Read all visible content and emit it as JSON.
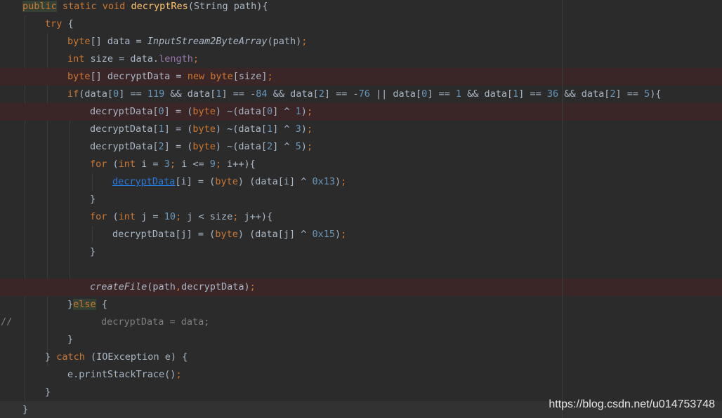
{
  "lines": [
    {
      "indent": 1,
      "parts": [
        {
          "t": "public",
          "c": "kw kwhl"
        },
        {
          "t": " static void ",
          "c": "kw"
        },
        {
          "t": "decryptRes",
          "c": "fn"
        },
        {
          "t": "(String path){",
          "c": ""
        }
      ]
    },
    {
      "indent": 2,
      "parts": [
        {
          "t": "try",
          "c": "kw"
        },
        {
          "t": " {",
          "c": ""
        }
      ]
    },
    {
      "indent": 3,
      "parts": [
        {
          "t": "byte",
          "c": "kw"
        },
        {
          "t": "[] data = ",
          "c": ""
        },
        {
          "t": "InputStream2ByteArray",
          "c": "st"
        },
        {
          "t": "(path)",
          "c": ""
        },
        {
          "t": ";",
          "c": "kw"
        }
      ]
    },
    {
      "indent": 3,
      "parts": [
        {
          "t": "int",
          "c": "kw"
        },
        {
          "t": " size = data.",
          "c": ""
        },
        {
          "t": "length",
          "c": "fld"
        },
        {
          "t": ";",
          "c": "kw"
        }
      ]
    },
    {
      "indent": 3,
      "style": "err",
      "parts": [
        {
          "t": "byte",
          "c": "kw"
        },
        {
          "t": "[] decryptData = ",
          "c": ""
        },
        {
          "t": "new ",
          "c": "kw"
        },
        {
          "t": "byte",
          "c": "kw"
        },
        {
          "t": "[size]",
          "c": ""
        },
        {
          "t": ";",
          "c": "kw"
        }
      ]
    },
    {
      "indent": 3,
      "parts": [
        {
          "t": "if",
          "c": "kw"
        },
        {
          "t": "(data[",
          "c": ""
        },
        {
          "t": "0",
          "c": "num"
        },
        {
          "t": "] == ",
          "c": ""
        },
        {
          "t": "119",
          "c": "num"
        },
        {
          "t": " && data[",
          "c": ""
        },
        {
          "t": "1",
          "c": "num"
        },
        {
          "t": "] == -",
          "c": ""
        },
        {
          "t": "84",
          "c": "num"
        },
        {
          "t": " && data[",
          "c": ""
        },
        {
          "t": "2",
          "c": "num"
        },
        {
          "t": "] == -",
          "c": ""
        },
        {
          "t": "76",
          "c": "num"
        },
        {
          "t": " || data[",
          "c": ""
        },
        {
          "t": "0",
          "c": "num"
        },
        {
          "t": "] == ",
          "c": ""
        },
        {
          "t": "1",
          "c": "num"
        },
        {
          "t": " && data[",
          "c": ""
        },
        {
          "t": "1",
          "c": "num"
        },
        {
          "t": "] == ",
          "c": ""
        },
        {
          "t": "36",
          "c": "num"
        },
        {
          "t": " && data[",
          "c": ""
        },
        {
          "t": "2",
          "c": "num"
        },
        {
          "t": "] == ",
          "c": ""
        },
        {
          "t": "5",
          "c": "num"
        },
        {
          "t": "){",
          "c": ""
        }
      ]
    },
    {
      "indent": 4,
      "style": "err",
      "parts": [
        {
          "t": "decryptData[",
          "c": ""
        },
        {
          "t": "0",
          "c": "num"
        },
        {
          "t": "] = (",
          "c": ""
        },
        {
          "t": "byte",
          "c": "kw"
        },
        {
          "t": ") ~(data[",
          "c": ""
        },
        {
          "t": "0",
          "c": "num"
        },
        {
          "t": "] ^ ",
          "c": ""
        },
        {
          "t": "1",
          "c": "num"
        },
        {
          "t": ")",
          "c": ""
        },
        {
          "t": ";",
          "c": "kw"
        }
      ]
    },
    {
      "indent": 4,
      "parts": [
        {
          "t": "decryptData[",
          "c": ""
        },
        {
          "t": "1",
          "c": "num"
        },
        {
          "t": "] = (",
          "c": ""
        },
        {
          "t": "byte",
          "c": "kw"
        },
        {
          "t": ") ~(data[",
          "c": ""
        },
        {
          "t": "1",
          "c": "num"
        },
        {
          "t": "] ^ ",
          "c": ""
        },
        {
          "t": "3",
          "c": "num"
        },
        {
          "t": ")",
          "c": ""
        },
        {
          "t": ";",
          "c": "kw"
        }
      ]
    },
    {
      "indent": 4,
      "parts": [
        {
          "t": "decryptData[",
          "c": ""
        },
        {
          "t": "2",
          "c": "num"
        },
        {
          "t": "] = (",
          "c": ""
        },
        {
          "t": "byte",
          "c": "kw"
        },
        {
          "t": ") ~(data[",
          "c": ""
        },
        {
          "t": "2",
          "c": "num"
        },
        {
          "t": "] ^ ",
          "c": ""
        },
        {
          "t": "5",
          "c": "num"
        },
        {
          "t": ")",
          "c": ""
        },
        {
          "t": ";",
          "c": "kw"
        }
      ]
    },
    {
      "indent": 4,
      "parts": [
        {
          "t": "for",
          "c": "kw"
        },
        {
          "t": " (",
          "c": ""
        },
        {
          "t": "int",
          "c": "kw"
        },
        {
          "t": " i = ",
          "c": ""
        },
        {
          "t": "3",
          "c": "num"
        },
        {
          "t": "; ",
          "c": "kw"
        },
        {
          "t": "i <= ",
          "c": ""
        },
        {
          "t": "9",
          "c": "num"
        },
        {
          "t": "; ",
          "c": "kw"
        },
        {
          "t": "i++){",
          "c": ""
        }
      ]
    },
    {
      "indent": 5,
      "parts": [
        {
          "t": "decryptData",
          "c": "link"
        },
        {
          "t": "[i] = (",
          "c": ""
        },
        {
          "t": "byte",
          "c": "kw"
        },
        {
          "t": ") (data[i] ^ ",
          "c": ""
        },
        {
          "t": "0x13",
          "c": "num"
        },
        {
          "t": ")",
          "c": ""
        },
        {
          "t": ";",
          "c": "kw"
        }
      ]
    },
    {
      "indent": 4,
      "parts": [
        {
          "t": "}",
          "c": ""
        }
      ]
    },
    {
      "indent": 4,
      "parts": [
        {
          "t": "for",
          "c": "kw"
        },
        {
          "t": " (",
          "c": ""
        },
        {
          "t": "int",
          "c": "kw"
        },
        {
          "t": " j = ",
          "c": ""
        },
        {
          "t": "10",
          "c": "num"
        },
        {
          "t": "; ",
          "c": "kw"
        },
        {
          "t": "j < size",
          "c": ""
        },
        {
          "t": "; ",
          "c": "kw"
        },
        {
          "t": "j++){",
          "c": ""
        }
      ]
    },
    {
      "indent": 5,
      "parts": [
        {
          "t": "decryptData[j] = (",
          "c": ""
        },
        {
          "t": "byte",
          "c": "kw"
        },
        {
          "t": ") (data[j] ^ ",
          "c": ""
        },
        {
          "t": "0x15",
          "c": "num"
        },
        {
          "t": ")",
          "c": ""
        },
        {
          "t": ";",
          "c": "kw"
        }
      ]
    },
    {
      "indent": 4,
      "parts": [
        {
          "t": "}",
          "c": ""
        }
      ]
    },
    {
      "indent": 4,
      "parts": []
    },
    {
      "indent": 4,
      "style": "err",
      "parts": [
        {
          "t": "createFile",
          "c": "st"
        },
        {
          "t": "(path",
          "c": ""
        },
        {
          "t": ",",
          "c": "kw"
        },
        {
          "t": "decryptData)",
          "c": ""
        },
        {
          "t": ";",
          "c": "kw"
        }
      ]
    },
    {
      "indent": 3,
      "parts": [
        {
          "t": "}",
          "c": ""
        },
        {
          "t": "else",
          "c": "kw kwhl"
        },
        {
          "t": " {",
          "c": ""
        }
      ]
    },
    {
      "indent": 4.5,
      "gutter": "//",
      "parts": [
        {
          "t": "decryptData = data;",
          "c": "cmt"
        }
      ]
    },
    {
      "indent": 3,
      "parts": [
        {
          "t": "}",
          "c": ""
        }
      ]
    },
    {
      "indent": 2,
      "parts": [
        {
          "t": "} ",
          "c": ""
        },
        {
          "t": "catch",
          "c": "kw"
        },
        {
          "t": " (IOException e) {",
          "c": ""
        }
      ]
    },
    {
      "indent": 3,
      "parts": [
        {
          "t": "e.printStackTrace()",
          "c": ""
        },
        {
          "t": ";",
          "c": "kw"
        }
      ]
    },
    {
      "indent": 2,
      "parts": [
        {
          "t": "}",
          "c": ""
        }
      ]
    },
    {
      "indent": 1,
      "style": "cur",
      "parts": [
        {
          "t": "}",
          "c": ""
        }
      ]
    }
  ],
  "watermark": "https://blog.csdn.net/u014753748"
}
